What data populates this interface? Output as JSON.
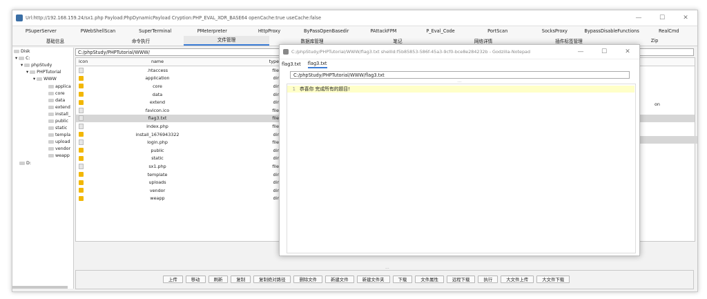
{
  "window": {
    "title": "Url:http://192.168.159.24/sx1.php Payload:PhpDynamicPayload Cryption:PHP_EVAL_XOR_BASE64 openCache:true useCache:false",
    "controls": [
      "—",
      "☐",
      "✕"
    ]
  },
  "menu_row1": [
    "PSuperServer",
    "PWebShellScan",
    "SuperTerminal",
    "PMeterpreter",
    "HttpProxy",
    "ByPassOpenBasedir",
    "PAttackFPM",
    "P_Eval_Code",
    "PortScan",
    "SocksProxy",
    "BypassDisableFunctions",
    "RealCmd"
  ],
  "menu_row2": [
    "基础信息",
    "命令执行",
    "文件管理",
    "数据库管理",
    "笔记",
    "网络详情",
    "插件标签管理",
    "Zip"
  ],
  "menu_row2_active": 2,
  "tree": {
    "items": [
      "Disk",
      "C:",
      "phpStudy",
      "PHPTutorial",
      "WWW",
      "applica",
      "core",
      "data",
      "extend",
      "install_",
      "public",
      "static",
      "templa",
      "upload",
      "vendor",
      "weapp",
      "D:"
    ]
  },
  "file_manager": {
    "path": "C:/phpStudy/PHPTutorial/WWW/",
    "headers": [
      "icon",
      "name",
      "type"
    ],
    "extra_header_fragment": "on",
    "rows": [
      {
        "name": ".htaccess",
        "type": "file"
      },
      {
        "name": "application",
        "type": "dir"
      },
      {
        "name": "core",
        "type": "dir"
      },
      {
        "name": "data",
        "type": "dir"
      },
      {
        "name": "extend",
        "type": "dir"
      },
      {
        "name": "favicon.ico",
        "type": "file"
      },
      {
        "name": "flag3.txt",
        "type": "file",
        "selected": true
      },
      {
        "name": "index.php",
        "type": "file"
      },
      {
        "name": "install_1676943322",
        "type": "dir"
      },
      {
        "name": "login.php",
        "type": "file"
      },
      {
        "name": "public",
        "type": "dir"
      },
      {
        "name": "static",
        "type": "dir"
      },
      {
        "name": "sx1.php",
        "type": "file"
      },
      {
        "name": "template",
        "type": "dir"
      },
      {
        "name": "uploads",
        "type": "dir"
      },
      {
        "name": "vendor",
        "type": "dir"
      },
      {
        "name": "weapp",
        "type": "dir"
      }
    ]
  },
  "notepad": {
    "title": "C:/phpStudy/PHPTutorial/WWW/flag3.txt   shellId:f5b85853-586f-45a3-9cf0-bce8e284232b   - Godzilla-Notepad",
    "tabs": [
      "flag3.txt",
      "flag3.txt"
    ],
    "path": "C:/phpStudy/PHPTutorial/WWW/flag3.txt",
    "line_number": "1",
    "content": "恭喜你 完成所有的题目!",
    "grip": "..."
  },
  "bottom_buttons": [
    "上传",
    "移动",
    "刷新",
    "复制",
    "复制绝对路径",
    "删除文件",
    "新建文件",
    "新建文件夹",
    "下载",
    "文件属性",
    "远程下载",
    "执行",
    "大文件上传",
    "大文件下载"
  ],
  "bottom_grip": "..."
}
